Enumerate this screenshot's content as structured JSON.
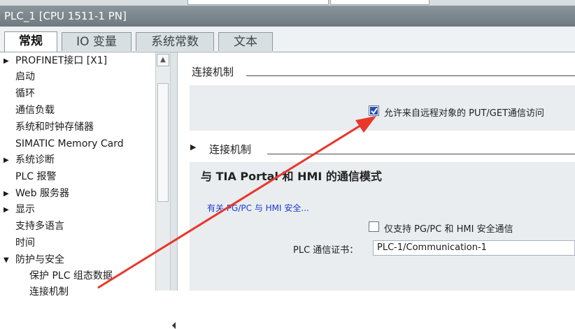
{
  "window": {
    "title": "PLC_1 [CPU 1511-1 PN]"
  },
  "tabs": [
    {
      "label": "常规",
      "active": true
    },
    {
      "label": "IO 变量",
      "active": false
    },
    {
      "label": "系统常数",
      "active": false
    },
    {
      "label": "文本",
      "active": false
    }
  ],
  "sidebar": {
    "items": [
      {
        "label": "PROFINET接口 [X1]",
        "arrow": "▶"
      },
      {
        "label": "启动",
        "arrow": ""
      },
      {
        "label": "循环",
        "arrow": ""
      },
      {
        "label": "通信负载",
        "arrow": ""
      },
      {
        "label": "系统和时钟存储器",
        "arrow": ""
      },
      {
        "label": "SIMATIC Memory Card",
        "arrow": ""
      },
      {
        "label": "系统诊断",
        "arrow": "▶"
      },
      {
        "label": "PLC 报警",
        "arrow": ""
      },
      {
        "label": "Web 服务器",
        "arrow": "▶"
      },
      {
        "label": "显示",
        "arrow": "▶"
      },
      {
        "label": "支持多语言",
        "arrow": ""
      },
      {
        "label": "时间",
        "arrow": ""
      },
      {
        "label": "防护与安全",
        "arrow": "▼"
      },
      {
        "label": "保护 PLC 组态数据",
        "arrow": ""
      },
      {
        "label": "连接机制",
        "arrow": ""
      }
    ]
  },
  "main": {
    "section1": {
      "title": "连接机制",
      "put_get": {
        "label": "允许来自远程对象的 PUT/GET通信访问",
        "checked": true
      }
    },
    "section2": {
      "title": "连接机制",
      "heading": "与 TIA Portal 和 HMI 的通信模式",
      "link": "有关 PG/PC 与 HMI 安全...",
      "secure_only": {
        "label": "仅支持 PG/PC 和 HMI 安全通信",
        "checked": false
      },
      "cert_label": "PLC 通信证书：",
      "cert_value": "PLC-1/Communication-1"
    }
  },
  "annotation": {
    "arrow_color": "#e8382c"
  },
  "icons": {
    "scroll_up": "chevron-up-icon",
    "collapse_panel": "triangle-left-icon"
  }
}
